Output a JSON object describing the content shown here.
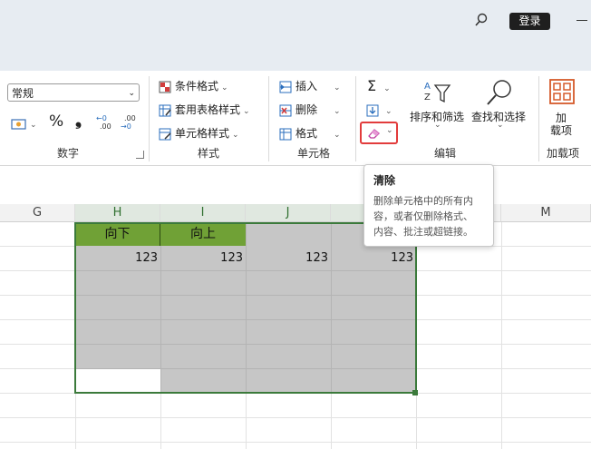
{
  "titlebar": {
    "login_label": "登录"
  },
  "ribbon": {
    "number_group": {
      "format_value": "常规",
      "percent": "%",
      "comma": "❟",
      "label": "数字"
    },
    "styles_group": {
      "conditional": "条件格式",
      "table_style": "套用表格样式",
      "cell_style": "单元格样式",
      "label": "样式"
    },
    "cells_group": {
      "insert": "插入",
      "delete": "删除",
      "format": "格式",
      "label": "单元格"
    },
    "edit_group": {
      "sort_filter": "排序和筛选",
      "find_select": "查找和选择",
      "label": "编辑"
    },
    "addin_group": {
      "addin_line1": "加",
      "addin_line2": "载项",
      "label": "加载项"
    }
  },
  "tooltip": {
    "title": "清除",
    "lines": [
      "删除单元格中的所有内",
      "容，或者仅删除格式、",
      "内容、批注或超链接。"
    ]
  },
  "columns": [
    "G",
    "H",
    "I",
    "J",
    "M"
  ],
  "sheet": {
    "headers": [
      "向下",
      "向上"
    ],
    "values": [
      "123",
      "123",
      "123",
      "123"
    ]
  },
  "colors": {
    "accent_green": "#70a136",
    "selection_gray": "#c6c6c6",
    "highlight_red": "#e23c3c"
  }
}
